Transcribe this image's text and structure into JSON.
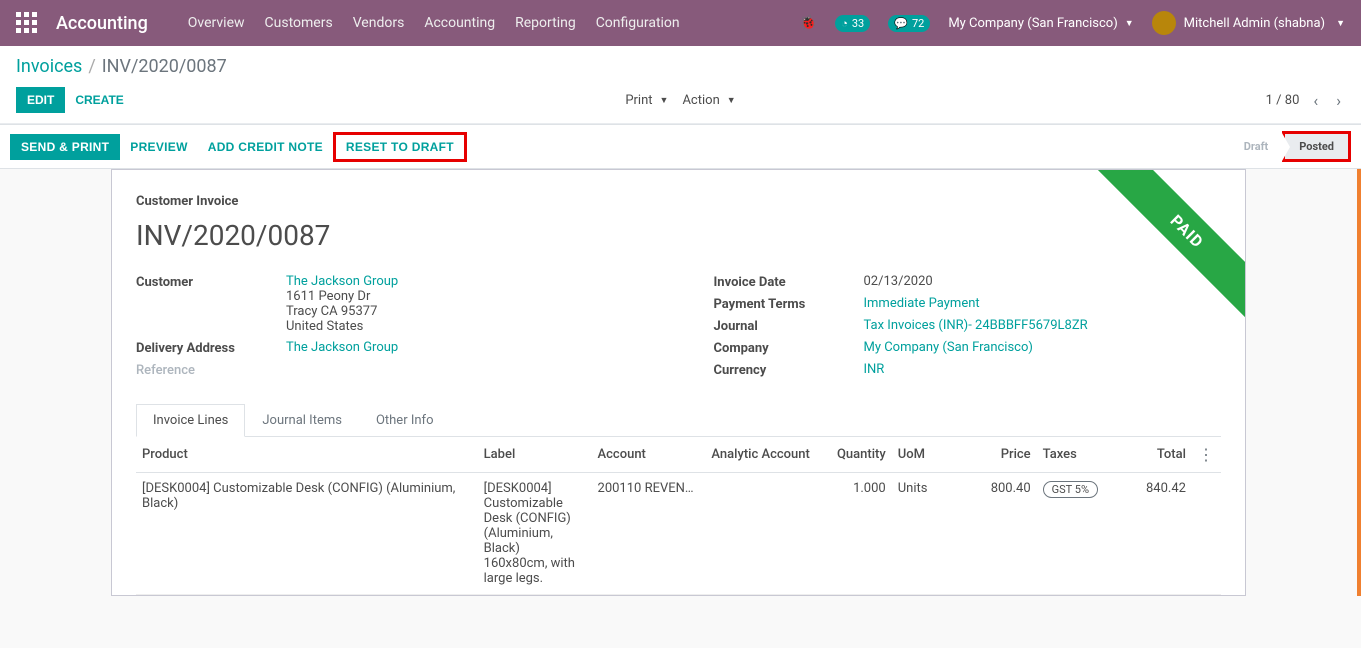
{
  "nav": {
    "brand": "Accounting",
    "items": [
      "Overview",
      "Customers",
      "Vendors",
      "Accounting",
      "Reporting",
      "Configuration"
    ],
    "badges": {
      "activities": "33",
      "discuss": "72"
    },
    "company": "My Company (San Francisco)",
    "user": "Mitchell Admin (shabna)"
  },
  "breadcrumbs": {
    "root": "Invoices",
    "current": "INV/2020/0087"
  },
  "controls": {
    "edit": "Edit",
    "create": "Create",
    "print": "Print",
    "action": "Action",
    "pager": "1 / 80"
  },
  "statusbar": {
    "send_print": "Send & Print",
    "preview": "Preview",
    "add_credit": "Add Credit Note",
    "reset_draft": "Reset to Draft",
    "stages": {
      "draft": "Draft",
      "posted": "Posted"
    }
  },
  "form": {
    "ribbon": "PAID",
    "section": "Customer Invoice",
    "name": "INV/2020/0087",
    "labels": {
      "customer": "Customer",
      "delivery": "Delivery Address",
      "reference": "Reference",
      "invoice_date": "Invoice Date",
      "payment_terms": "Payment Terms",
      "journal": "Journal",
      "company": "Company",
      "currency": "Currency"
    },
    "customer": {
      "name": "The Jackson Group",
      "street": "1611 Peony Dr",
      "city": "Tracy CA 95377",
      "country": "United States"
    },
    "delivery_address": "The Jackson Group",
    "invoice_date": "02/13/2020",
    "payment_terms": "Immediate Payment",
    "journal": "Tax Invoices (INR)- 24BBBFF5679L8ZR",
    "company": "My Company (San Francisco)",
    "currency": "INR"
  },
  "tabs": {
    "lines": "Invoice Lines",
    "journal": "Journal Items",
    "other": "Other Info"
  },
  "table": {
    "headers": {
      "product": "Product",
      "label": "Label",
      "account": "Account",
      "analytic": "Analytic Account",
      "quantity": "Quantity",
      "uom": "UoM",
      "price": "Price",
      "taxes": "Taxes",
      "total": "Total"
    },
    "row": {
      "product": "[DESK0004] Customizable Desk (CONFIG) (Aluminium, Black)",
      "label": "[DESK0004] Customizable Desk (CONFIG) (Aluminium, Black) 160x80cm, with large legs.",
      "account": "200110 REVEN…",
      "analytic": "",
      "quantity": "1.000",
      "uom": "Units",
      "price": "800.40",
      "tax": "GST 5%",
      "total": "840.42"
    }
  }
}
